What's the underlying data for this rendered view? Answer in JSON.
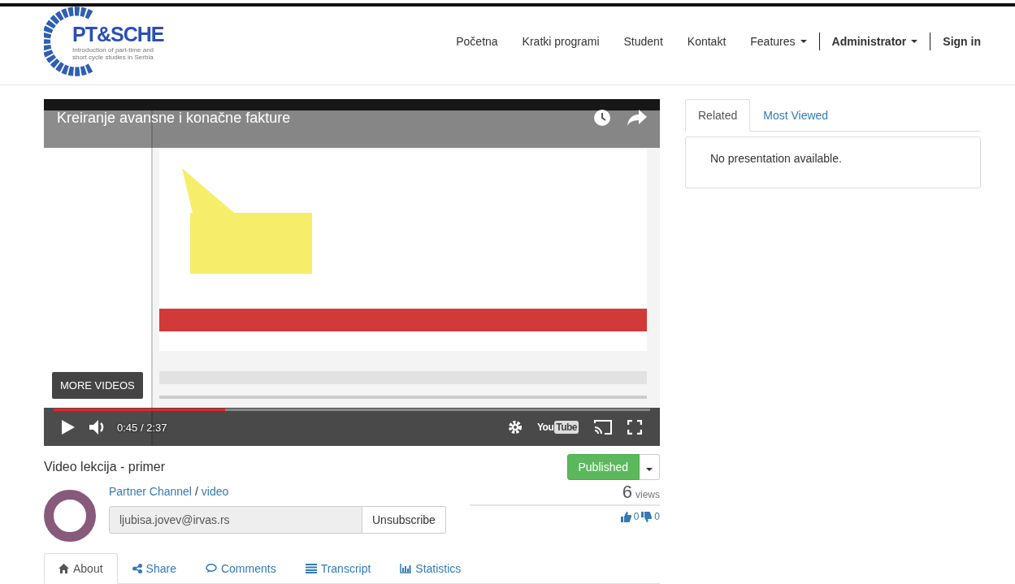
{
  "logo": {
    "name": "PT&SCHE",
    "tagline": "Introduction of part-time and short cycle studies in Serbia"
  },
  "nav": [
    {
      "label": "Početna",
      "kind": "link"
    },
    {
      "label": "Kratki programi",
      "kind": "link"
    },
    {
      "label": "Student",
      "kind": "link"
    },
    {
      "label": "Kontakt",
      "kind": "link"
    },
    {
      "label": "Features",
      "kind": "dropdown"
    },
    {
      "label": "Administrator",
      "kind": "user"
    },
    {
      "label": "Sign in",
      "kind": "signin"
    }
  ],
  "video": {
    "title": "Kreiranje avansne i konačne fakture",
    "more": "MORE VIDEOS",
    "time": "0:45 / 2:37",
    "progress": {
      "level": 0.287
    },
    "logo": [
      "You",
      "Tube"
    ]
  },
  "lesson": {
    "title": "Video lekcija - primer",
    "status": "Published",
    "channel": "Partner Channel",
    "separator": "/",
    "category": "video",
    "email": "ljubisa.jovev@irvas.rs",
    "unsubscribe": "Unsubscribe",
    "views": "6",
    "views_label": "views",
    "likes": "0",
    "dislikes": "0"
  },
  "tabs": [
    {
      "label": "About",
      "kind": "home",
      "selected": true
    },
    {
      "label": "Share",
      "kind": "share",
      "selected": false
    },
    {
      "label": "Comments",
      "kind": "comment",
      "selected": false
    },
    {
      "label": "Transcript",
      "kind": "list",
      "selected": false
    },
    {
      "label": "Statistics",
      "kind": "chart",
      "selected": false
    }
  ],
  "side_tabs": [
    {
      "label": "Related",
      "selected": true
    },
    {
      "label": "Most Viewed",
      "selected": false
    }
  ],
  "side_message": "No presentation available."
}
